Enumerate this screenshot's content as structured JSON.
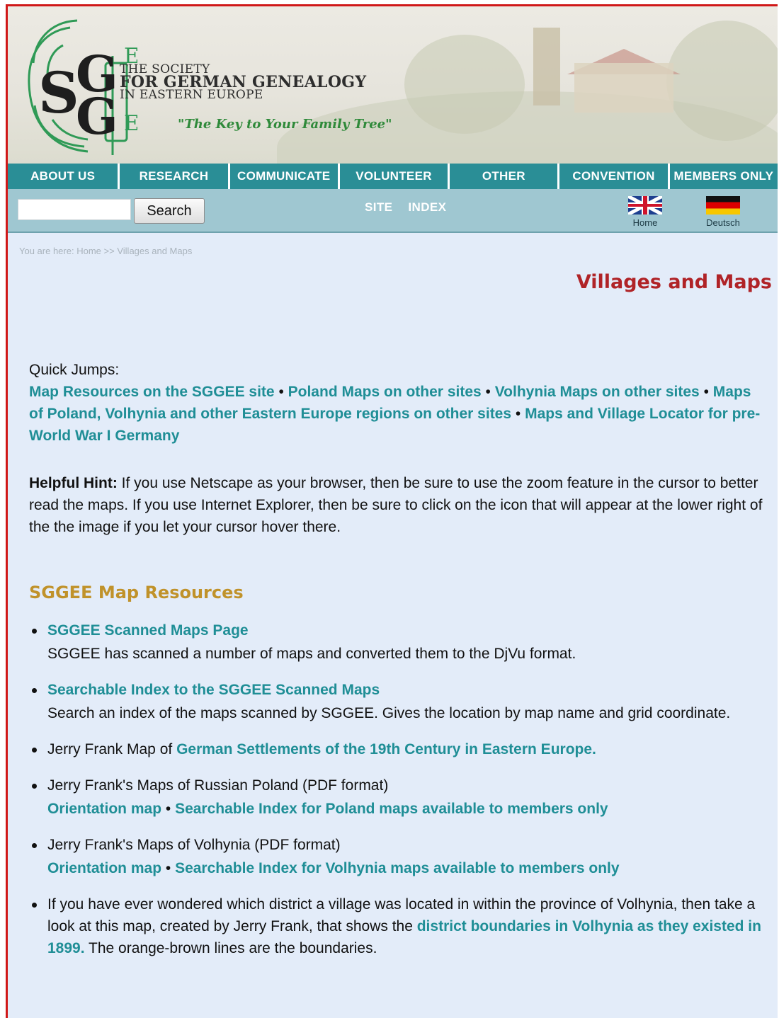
{
  "header": {
    "logo_letters": "SGGEE",
    "org_line1": "THE SOCIETY",
    "org_line2": "FOR GERMAN GENEALOGY",
    "org_line3": "IN EASTERN EUROPE",
    "tagline": "\"The Key to Your Family Tree\""
  },
  "nav": {
    "items": [
      "ABOUT US",
      "RESEARCH",
      "COMMUNICATE",
      "VOLUNTEER",
      "OTHER",
      "CONVENTION",
      "MEMBERS ONLY"
    ]
  },
  "search": {
    "value": "",
    "button_label": "Search",
    "site_link": "SITE",
    "index_link": "INDEX",
    "lang_en_label": "Home",
    "lang_de_label": "Deutsch"
  },
  "breadcrumb": {
    "prefix": "You are here:",
    "home": "Home",
    "sep": ">>",
    "current": "Villages and Maps"
  },
  "page_title": "Villages and Maps",
  "quick_jumps": {
    "label": "Quick Jumps:",
    "links": [
      "Map Resources on the SGGEE site",
      "Poland Maps on other sites",
      "Volhynia Maps on other sites",
      "Maps of Poland, Volhynia and other Eastern Europe regions on other sites",
      "Maps and Village Locator for pre-World War I Germany"
    ],
    "separator": "•"
  },
  "hint": {
    "label": "Helpful Hint:",
    "text": " If you use Netscape as your browser, then be sure to use the zoom feature in the cursor to better read the maps. If you use Internet Explorer, then be sure to click on the icon that will appear at the lower right of the the image if you let your cursor hover there."
  },
  "section": {
    "title": "SGGEE Map Resources",
    "items": [
      {
        "link": "SGGEE Scanned Maps Page",
        "desc": "SGGEE has scanned a number of maps and converted them to the DjVu format."
      },
      {
        "link": "Searchable Index to the SGGEE Scanned Maps",
        "desc": "Search an index of the maps scanned by SGGEE. Gives the location by map name and grid coordinate."
      },
      {
        "prefix": "Jerry Frank Map of ",
        "link": "German Settlements of the 19th Century in Eastern Europe."
      },
      {
        "text": "Jerry Frank's Maps of Russian Poland (PDF format)",
        "link1": "Orientation map",
        "sep": " • ",
        "link2": "Searchable Index for Poland maps available to members only"
      },
      {
        "text": "Jerry Frank's Maps of Volhynia (PDF format)",
        "link1": "Orientation map",
        "sep": " • ",
        "link2": "Searchable Index for Volhynia maps available to members only"
      },
      {
        "prefix": "If you have ever wondered which district a village was located in within the province of Volhynia, then take a look at this map, created by Jerry Frank, that shows the ",
        "link": "district boundaries in Volhynia as they existed in 1899.",
        "suffix": " The orange-brown lines are the boundaries."
      }
    ]
  },
  "colors": {
    "nav_bg": "#2a8e96",
    "link": "#1f8e96",
    "title": "#b02327",
    "section_title": "#c0922a",
    "frame_border": "#d01818",
    "content_bg": "#e3ecf9"
  }
}
